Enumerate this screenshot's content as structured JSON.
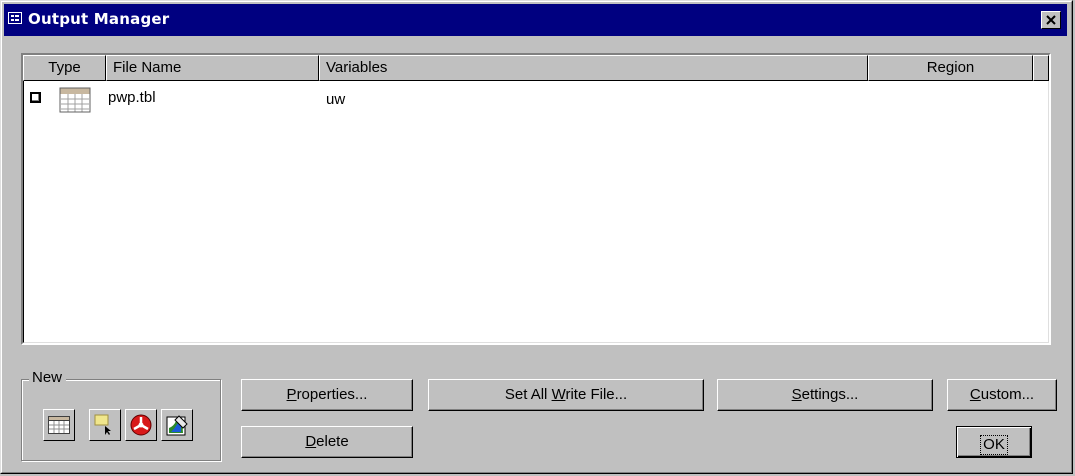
{
  "window": {
    "title": "Output Manager"
  },
  "listview": {
    "columns": [
      {
        "label": "Type"
      },
      {
        "label": "File Name"
      },
      {
        "label": "Variables"
      },
      {
        "label": "Region"
      }
    ],
    "rows": [
      {
        "type_icon": "table-icon",
        "file_name": "pwp.tbl",
        "variables": "uw",
        "region": ""
      }
    ]
  },
  "new_group": {
    "label": "New",
    "buttons": [
      {
        "icon": "new-table-icon"
      },
      {
        "icon": "new-pick-icon"
      },
      {
        "icon": "new-radial-icon"
      },
      {
        "icon": "new-contour-icon"
      }
    ]
  },
  "buttons": {
    "properties": {
      "pre": "",
      "key": "P",
      "post": "roperties..."
    },
    "delete": {
      "pre": "",
      "key": "D",
      "post": "elete"
    },
    "set_all": {
      "pre": "Set All ",
      "key": "W",
      "post": "rite File..."
    },
    "settings": {
      "pre": "",
      "key": "S",
      "post": "ettings..."
    },
    "custom": {
      "pre": "",
      "key": "C",
      "post": "ustom..."
    },
    "ok": {
      "label": "OK"
    }
  }
}
